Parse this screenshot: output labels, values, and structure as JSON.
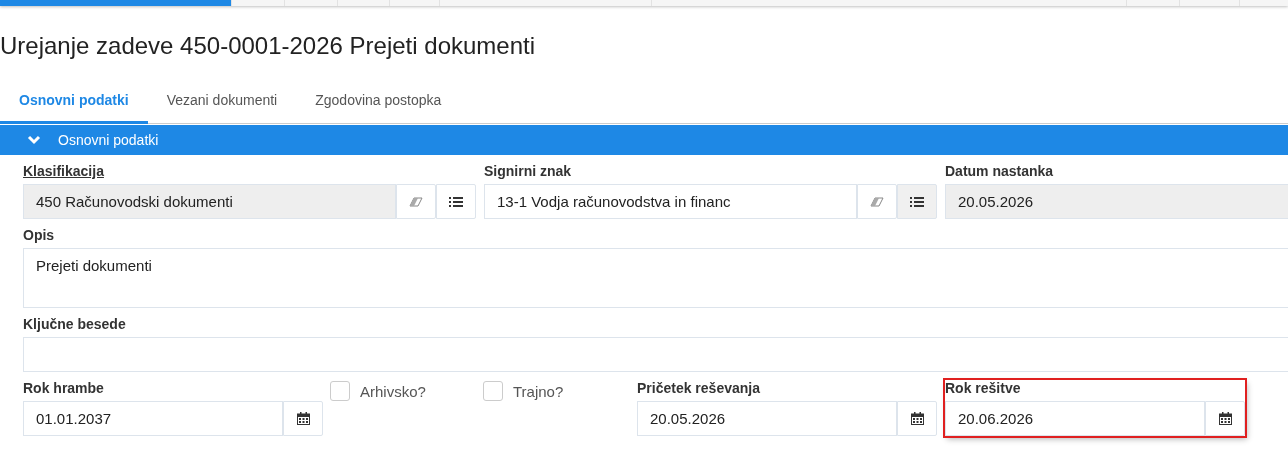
{
  "top_nav": [
    {
      "selected": true
    },
    {
      "selected": false
    },
    {
      "selected": false
    },
    {
      "selected": false
    },
    {
      "selected": false
    },
    {
      "selected": false
    },
    {
      "selected": false
    },
    {
      "selected": false
    },
    {
      "selected": false
    }
  ],
  "title": "Urejanje zadeve 450-0001-2026 Prejeti dokumenti",
  "tabs": [
    {
      "label": "Osnovni podatki",
      "selected": true
    },
    {
      "label": "Vezani dokumenti",
      "selected": false
    },
    {
      "label": "Zgodovina postopka",
      "selected": false
    }
  ],
  "section": {
    "title": "Osnovni podatki",
    "expanded": true
  },
  "rows": [
    {
      "fields": [
        {
          "kind": "lookup",
          "label": "Klasifikacija",
          "value": "450 Računovodski dokumenti",
          "readonly": true,
          "label_link": true
        },
        {
          "kind": "lookup",
          "label": "Signirni znak",
          "value": "13-1 Vodja računovodstva in financ",
          "readonly": false,
          "label_link": false
        },
        {
          "kind": "text",
          "label": "Datum nastanka",
          "value": "20.05.2026",
          "readonly": true
        }
      ]
    },
    {
      "fields": [
        {
          "kind": "textarea",
          "label": "Opis",
          "value": "Prejeti dokumenti"
        }
      ]
    },
    {
      "fields": [
        {
          "kind": "text",
          "label": "Ključne besede"
        }
      ]
    },
    {
      "fields": [
        {
          "kind": "date",
          "label": "Rok hrambe",
          "value": "01.01.2037",
          "highlighted": false
        },
        {
          "kind": "checkbox",
          "label": "Arhivsko?",
          "checked": false
        },
        {
          "kind": "checkbox",
          "label": "Trajno?",
          "checked": false
        },
        {
          "kind": "date",
          "label": "Pričetek reševanja",
          "value": "20.05.2026",
          "highlighted": false
        },
        {
          "kind": "date",
          "label": "Rok rešitve",
          "value": "20.06.2026",
          "highlighted": true
        }
      ]
    }
  ]
}
